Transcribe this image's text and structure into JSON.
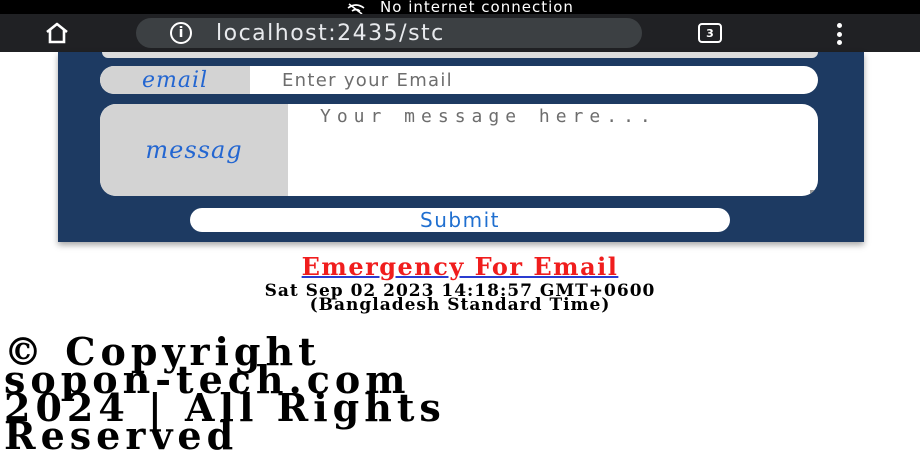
{
  "status_bar": {
    "text": "No internet connection",
    "icon": "no-internet-icon"
  },
  "browser": {
    "url": "localhost:2435/stc",
    "tab_count": "3",
    "icons": [
      "home-icon",
      "info-icon",
      "tabs-icon",
      "menu-icon"
    ]
  },
  "form": {
    "email_label": "email",
    "email_placeholder": "Enter your Email",
    "message_label": "messag",
    "message_placeholder": "Your message here...",
    "submit_label": "Submit"
  },
  "emergency_link": "Emergency For Email",
  "datetime": {
    "line1": "Sat Sep 02 2023 14:18:57 GMT+0600",
    "line2": "(Bangladesh Standard Time)"
  },
  "copyright": {
    "line1": "© Copyright",
    "line2": "sopon-tech.com",
    "line3": "2024 | All Rights",
    "line4": "Reserved"
  },
  "colors": {
    "card_bg": "#1d3a62",
    "label_text": "#2366d1",
    "emergency_text": "#f01d1d",
    "toolbar_bg": "#202124"
  }
}
